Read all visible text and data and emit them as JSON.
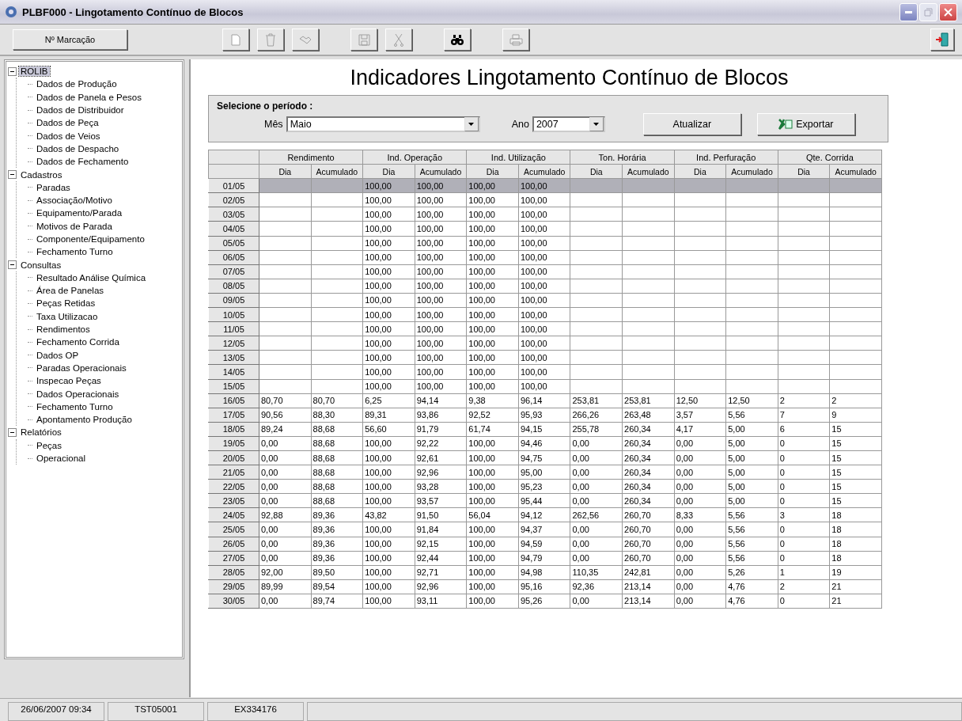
{
  "window": {
    "title": "PLBF000 - Lingotamento Contínuo de Blocos"
  },
  "toolbar": {
    "marking_button": "Nº Marcação",
    "tools": [
      {
        "kind": "new",
        "disabled": true
      },
      {
        "kind": "delete",
        "disabled": true
      },
      {
        "kind": "handshake",
        "disabled": true
      },
      {
        "kind": "save",
        "disabled": true
      },
      {
        "kind": "cut",
        "disabled": true
      },
      {
        "kind": "find",
        "disabled": false
      },
      {
        "kind": "print",
        "disabled": true
      }
    ]
  },
  "tree": [
    {
      "label": "ROLIB",
      "expanded": true,
      "selected": true,
      "children": [
        {
          "label": "Dados de Produção",
          "selected": false
        },
        {
          "label": "Dados de Panela e Pesos",
          "selected": false
        },
        {
          "label": "Dados de Distribuidor",
          "selected": false
        },
        {
          "label": "Dados de Peça",
          "selected": false
        },
        {
          "label": "Dados de Veios",
          "selected": false
        },
        {
          "label": "Dados de Despacho",
          "selected": false
        },
        {
          "label": "Dados de Fechamento",
          "selected": false
        }
      ]
    },
    {
      "label": "Cadastros",
      "expanded": true,
      "selected": false,
      "children": [
        {
          "label": "Paradas",
          "selected": false
        },
        {
          "label": "Associação/Motivo",
          "selected": false
        },
        {
          "label": "Equipamento/Parada",
          "selected": false
        },
        {
          "label": "Motivos de Parada",
          "selected": false
        },
        {
          "label": "Componente/Equipamento",
          "selected": false
        },
        {
          "label": "Fechamento Turno",
          "selected": false
        }
      ]
    },
    {
      "label": "Consultas",
      "expanded": true,
      "selected": false,
      "children": [
        {
          "label": "Resultado Análise Química",
          "selected": false
        },
        {
          "label": "Área de Panelas",
          "selected": false
        },
        {
          "label": "Peças Retidas",
          "selected": false
        },
        {
          "label": "Taxa Utilizacao",
          "selected": false
        },
        {
          "label": "Rendimentos",
          "selected": false
        },
        {
          "label": "Fechamento Corrida",
          "selected": false
        },
        {
          "label": "Dados OP",
          "selected": false
        },
        {
          "label": "Paradas Operacionais",
          "selected": false
        },
        {
          "label": "Inspecao Peças",
          "selected": false
        },
        {
          "label": "Dados Operacionais",
          "selected": false
        },
        {
          "label": "Fechamento Turno",
          "selected": false
        },
        {
          "label": "Apontamento Produção",
          "selected": false
        }
      ]
    },
    {
      "label": "Relatórios",
      "expanded": true,
      "selected": false,
      "children": [
        {
          "label": "Peças",
          "selected": false
        },
        {
          "label": "Operacional",
          "selected": false
        }
      ]
    }
  ],
  "heading": "Indicadores Lingotamento Contínuo de Blocos",
  "period": {
    "title": "Selecione o período :",
    "month_label": "Mês",
    "month": "Maio",
    "year_label": "Ano",
    "year": "2007",
    "update_button": "Atualizar",
    "export_button": "Exportar"
  },
  "table": {
    "groups": [
      "Rendimento",
      "Ind. Operação",
      "Ind. Utilização",
      "Ton. Horária",
      "Ind. Perfuração",
      "Qte. Corrida"
    ],
    "subcolumns": [
      "Dia",
      "Acumulado",
      "Dia",
      "Acumulado",
      "Dia",
      "Acumulado",
      "Dia",
      "Acumulado",
      "Dia",
      "Acumulado",
      "Dia",
      "Acumulado"
    ],
    "rows": [
      {
        "date": "01/05",
        "selected": true,
        "cells": [
          null,
          null,
          "100,00",
          "100,00",
          "100,00",
          "100,00",
          null,
          null,
          null,
          null,
          null,
          null
        ]
      },
      {
        "date": "02/05",
        "selected": false,
        "cells": [
          null,
          null,
          "100,00",
          "100,00",
          "100,00",
          "100,00",
          null,
          null,
          null,
          null,
          null,
          null
        ]
      },
      {
        "date": "03/05",
        "selected": false,
        "cells": [
          null,
          null,
          "100,00",
          "100,00",
          "100,00",
          "100,00",
          null,
          null,
          null,
          null,
          null,
          null
        ]
      },
      {
        "date": "04/05",
        "selected": false,
        "cells": [
          null,
          null,
          "100,00",
          "100,00",
          "100,00",
          "100,00",
          null,
          null,
          null,
          null,
          null,
          null
        ]
      },
      {
        "date": "05/05",
        "selected": false,
        "cells": [
          null,
          null,
          "100,00",
          "100,00",
          "100,00",
          "100,00",
          null,
          null,
          null,
          null,
          null,
          null
        ]
      },
      {
        "date": "06/05",
        "selected": false,
        "cells": [
          null,
          null,
          "100,00",
          "100,00",
          "100,00",
          "100,00",
          null,
          null,
          null,
          null,
          null,
          null
        ]
      },
      {
        "date": "07/05",
        "selected": false,
        "cells": [
          null,
          null,
          "100,00",
          "100,00",
          "100,00",
          "100,00",
          null,
          null,
          null,
          null,
          null,
          null
        ]
      },
      {
        "date": "08/05",
        "selected": false,
        "cells": [
          null,
          null,
          "100,00",
          "100,00",
          "100,00",
          "100,00",
          null,
          null,
          null,
          null,
          null,
          null
        ]
      },
      {
        "date": "09/05",
        "selected": false,
        "cells": [
          null,
          null,
          "100,00",
          "100,00",
          "100,00",
          "100,00",
          null,
          null,
          null,
          null,
          null,
          null
        ]
      },
      {
        "date": "10/05",
        "selected": false,
        "cells": [
          null,
          null,
          "100,00",
          "100,00",
          "100,00",
          "100,00",
          null,
          null,
          null,
          null,
          null,
          null
        ]
      },
      {
        "date": "11/05",
        "selected": false,
        "cells": [
          null,
          null,
          "100,00",
          "100,00",
          "100,00",
          "100,00",
          null,
          null,
          null,
          null,
          null,
          null
        ]
      },
      {
        "date": "12/05",
        "selected": false,
        "cells": [
          null,
          null,
          "100,00",
          "100,00",
          "100,00",
          "100,00",
          null,
          null,
          null,
          null,
          null,
          null
        ]
      },
      {
        "date": "13/05",
        "selected": false,
        "cells": [
          null,
          null,
          "100,00",
          "100,00",
          "100,00",
          "100,00",
          null,
          null,
          null,
          null,
          null,
          null
        ]
      },
      {
        "date": "14/05",
        "selected": false,
        "cells": [
          null,
          null,
          "100,00",
          "100,00",
          "100,00",
          "100,00",
          null,
          null,
          null,
          null,
          null,
          null
        ]
      },
      {
        "date": "15/05",
        "selected": false,
        "cells": [
          null,
          null,
          "100,00",
          "100,00",
          "100,00",
          "100,00",
          null,
          null,
          null,
          null,
          null,
          null
        ]
      },
      {
        "date": "16/05",
        "selected": false,
        "cells": [
          "80,70",
          "80,70",
          "6,25",
          "94,14",
          "9,38",
          "96,14",
          "253,81",
          "253,81",
          "12,50",
          "12,50",
          "2",
          "2"
        ]
      },
      {
        "date": "17/05",
        "selected": false,
        "cells": [
          "90,56",
          "88,30",
          "89,31",
          "93,86",
          "92,52",
          "95,93",
          "266,26",
          "263,48",
          "3,57",
          "5,56",
          "7",
          "9"
        ]
      },
      {
        "date": "18/05",
        "selected": false,
        "cells": [
          "89,24",
          "88,68",
          "56,60",
          "91,79",
          "61,74",
          "94,15",
          "255,78",
          "260,34",
          "4,17",
          "5,00",
          "6",
          "15"
        ]
      },
      {
        "date": "19/05",
        "selected": false,
        "cells": [
          "0,00",
          "88,68",
          "100,00",
          "92,22",
          "100,00",
          "94,46",
          "0,00",
          "260,34",
          "0,00",
          "5,00",
          "0",
          "15"
        ]
      },
      {
        "date": "20/05",
        "selected": false,
        "cells": [
          "0,00",
          "88,68",
          "100,00",
          "92,61",
          "100,00",
          "94,75",
          "0,00",
          "260,34",
          "0,00",
          "5,00",
          "0",
          "15"
        ]
      },
      {
        "date": "21/05",
        "selected": false,
        "cells": [
          "0,00",
          "88,68",
          "100,00",
          "92,96",
          "100,00",
          "95,00",
          "0,00",
          "260,34",
          "0,00",
          "5,00",
          "0",
          "15"
        ]
      },
      {
        "date": "22/05",
        "selected": false,
        "cells": [
          "0,00",
          "88,68",
          "100,00",
          "93,28",
          "100,00",
          "95,23",
          "0,00",
          "260,34",
          "0,00",
          "5,00",
          "0",
          "15"
        ]
      },
      {
        "date": "23/05",
        "selected": false,
        "cells": [
          "0,00",
          "88,68",
          "100,00",
          "93,57",
          "100,00",
          "95,44",
          "0,00",
          "260,34",
          "0,00",
          "5,00",
          "0",
          "15"
        ]
      },
      {
        "date": "24/05",
        "selected": false,
        "cells": [
          "92,88",
          "89,36",
          "43,82",
          "91,50",
          "56,04",
          "94,12",
          "262,56",
          "260,70",
          "8,33",
          "5,56",
          "3",
          "18"
        ]
      },
      {
        "date": "25/05",
        "selected": false,
        "cells": [
          "0,00",
          "89,36",
          "100,00",
          "91,84",
          "100,00",
          "94,37",
          "0,00",
          "260,70",
          "0,00",
          "5,56",
          "0",
          "18"
        ]
      },
      {
        "date": "26/05",
        "selected": false,
        "cells": [
          "0,00",
          "89,36",
          "100,00",
          "92,15",
          "100,00",
          "94,59",
          "0,00",
          "260,70",
          "0,00",
          "5,56",
          "0",
          "18"
        ]
      },
      {
        "date": "27/05",
        "selected": false,
        "cells": [
          "0,00",
          "89,36",
          "100,00",
          "92,44",
          "100,00",
          "94,79",
          "0,00",
          "260,70",
          "0,00",
          "5,56",
          "0",
          "18"
        ]
      },
      {
        "date": "28/05",
        "selected": false,
        "cells": [
          "92,00",
          "89,50",
          "100,00",
          "92,71",
          "100,00",
          "94,98",
          "110,35",
          "242,81",
          "0,00",
          "5,26",
          "1",
          "19"
        ]
      },
      {
        "date": "29/05",
        "selected": false,
        "cells": [
          "89,99",
          "89,54",
          "100,00",
          "92,96",
          "100,00",
          "95,16",
          "92,36",
          "213,14",
          "0,00",
          "4,76",
          "2",
          "21"
        ]
      },
      {
        "date": "30/05",
        "selected": false,
        "cells": [
          "0,00",
          "89,74",
          "100,00",
          "93,11",
          "100,00",
          "95,26",
          "0,00",
          "213,14",
          "0,00",
          "4,76",
          "0",
          "21"
        ]
      }
    ]
  },
  "status_bar": [
    "26/06/2007 09:34",
    "TST05001",
    "EX334176"
  ]
}
